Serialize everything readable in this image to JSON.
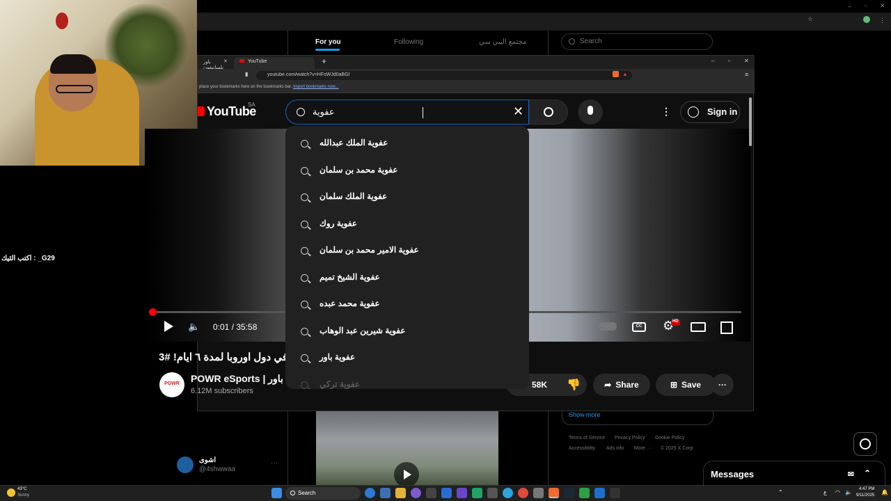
{
  "x_page": {
    "tabs": [
      "For you",
      "Following",
      "مجتمع اليبي سي"
    ],
    "search_placeholder": "Search",
    "show_more": "Show more",
    "footer": [
      "Terms of Service",
      "Privacy Policy",
      "Cookie Policy",
      "Accessibility",
      "Ads info",
      "More ···",
      "© 2025 X Corp."
    ],
    "post_author_name": "اشوى",
    "post_author_handle": "@4shwwaa",
    "messages_label": "Messages"
  },
  "stream": {
    "chat_line": "اكتب الثيك : _G29"
  },
  "browser": {
    "tabs": [
      {
        "label": "باور بلسانيفون"
      },
      {
        "label": "YouTube"
      }
    ],
    "url": "youtube.com/watch?v=HFsWJd0aBGI",
    "bookmarks_text": "place your bookmarks here on the bookmarks bar.",
    "bookmarks_link": "Import bookmarks now..."
  },
  "youtube": {
    "logo": "YouTube",
    "region": "SA",
    "search_value": "عفوية",
    "sign_in": "Sign in",
    "suggestions": [
      "عفوية الملك عبدالله",
      "عفوية محمد بن سلمان",
      "عفوية الملك سلمان",
      "عفوية روك",
      "عفوية الامير محمد بن سلمان",
      "عفوية الشيخ تميم",
      "عفوية محمد عبده",
      "عفوية شيرين عبد الوهاب",
      "عفوية باور",
      "عفوية تركي"
    ],
    "player": {
      "time": "0:01 / 35:58",
      "hd_badge": "HD",
      "progress_fraction": 0.0005
    },
    "video_title": "في دول اوروبا لمدة ٦ ايام! #3",
    "channel_name": "POWR eSports | باور",
    "channel_avatar": "POWR",
    "subscribers": "6.12M subscribers",
    "likes": "58K",
    "share": "Share",
    "save": "Save"
  },
  "taskbar": {
    "weather_temp": "43°C",
    "weather_desc": "Sunny",
    "search": "Search",
    "time": "4:47 PM",
    "date": "9/11/2025",
    "lang": "ع"
  },
  "colors": {
    "accent": "#ff0000",
    "search_focus": "#1c62b9",
    "link": "#8ab4f8"
  }
}
